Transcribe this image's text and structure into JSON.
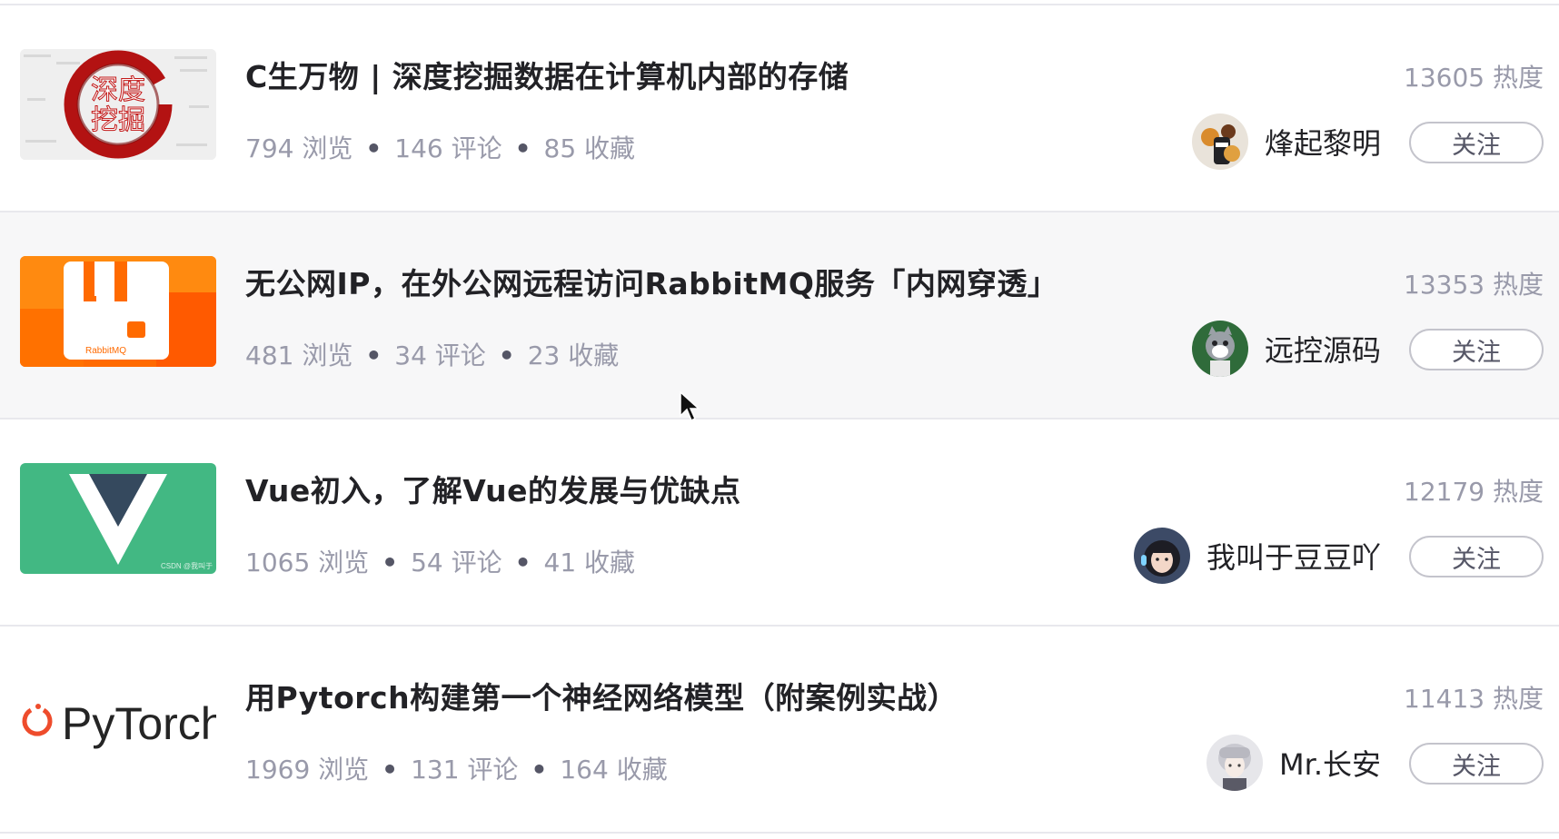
{
  "articles": [
    {
      "title": "C生万物 | 深度挖掘数据在计算机内部的存储",
      "views": "794 浏览",
      "comments": "146 评论",
      "favorites": "85 收藏",
      "heat": "13605 热度",
      "author": "烽起黎明",
      "follow_label": "关注",
      "thumb_text_1": "深度",
      "thumb_text_2": "挖掘",
      "thumb_icon": "ink-circle-icon",
      "avatar_icon": "avatar-icon"
    },
    {
      "title": "无公网IP，在外公网远程访问RabbitMQ服务「内网穿透」",
      "views": "481 浏览",
      "comments": "34 评论",
      "favorites": "23 收藏",
      "heat": "13353 热度",
      "author": "远控源码",
      "follow_label": "关注",
      "thumb_logo_text": "RabbitMQ",
      "thumb_icon": "rabbitmq-logo-icon",
      "avatar_icon": "avatar-icon"
    },
    {
      "title": "Vue初入，了解Vue的发展与优缺点",
      "views": "1065 浏览",
      "comments": "54 评论",
      "favorites": "41 收藏",
      "heat": "12179 热度",
      "author": "我叫于豆豆吖",
      "follow_label": "关注",
      "thumb_watermark": "CSDN @我叫于",
      "thumb_icon": "vue-logo-icon",
      "avatar_icon": "avatar-icon"
    },
    {
      "title": "用Pytorch构建第一个神经网络模型（附案例实战）",
      "views": "1969 浏览",
      "comments": "131 评论",
      "favorites": "164 收藏",
      "heat": "11413 热度",
      "author": "Mr.长安",
      "follow_label": "关注",
      "thumb_logo_text": "PyTorch",
      "thumb_icon": "pytorch-logo-icon",
      "avatar_icon": "avatar-icon"
    }
  ],
  "separator": "•",
  "colors": {
    "text_primary": "#222226",
    "text_secondary": "#999aaa",
    "row_hover": "#f7f7f8",
    "divider": "#e8e8ed",
    "rabbitmq_orange": "#ff6600",
    "vue_green": "#42b883",
    "vue_dark": "#35495e",
    "pytorch_red": "#ee4c2c"
  }
}
